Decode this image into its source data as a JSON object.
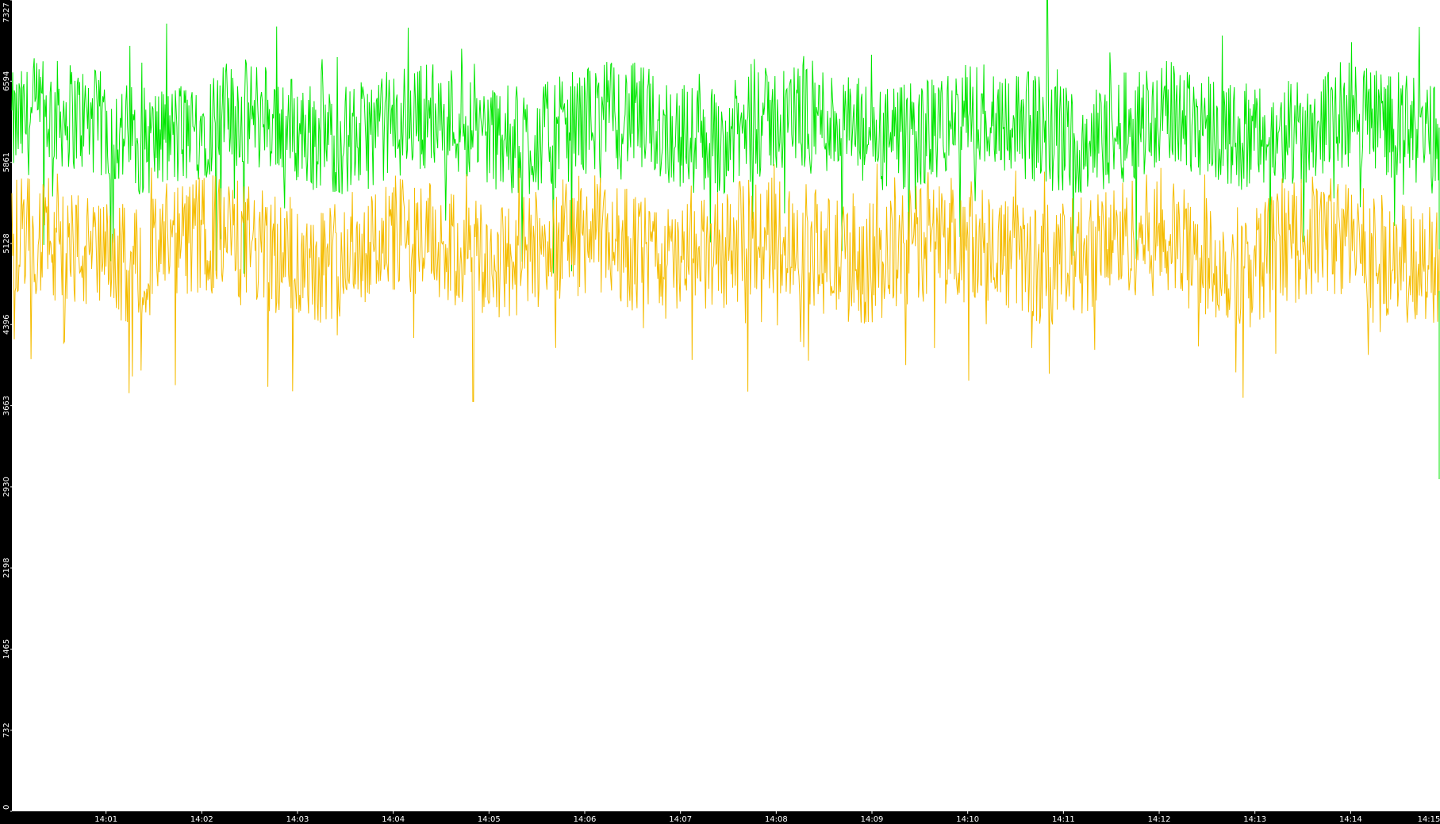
{
  "chart_data": {
    "type": "line",
    "title": "",
    "xlabel": "",
    "ylabel": "",
    "ylim": [
      0,
      7327
    ],
    "y_ticks": [
      0,
      732,
      1465,
      2198,
      2930,
      3663,
      4396,
      5128,
      5861,
      6594,
      7327
    ],
    "x_range": [
      "14:00:01",
      "14:14:56"
    ],
    "x_ticks": [
      "14:01",
      "14:02",
      "14:03",
      "14:04",
      "14:05",
      "14:06",
      "14:07",
      "14:08",
      "14:09",
      "14:10",
      "14:11",
      "14:12",
      "14:13",
      "14:14",
      "14:15"
    ],
    "grid": false,
    "legend": "none",
    "series": [
      {
        "color": "#00e600",
        "summary": {
          "typical_low": 5700,
          "typical_high": 6650,
          "min": 4800,
          "max": 7327,
          "last": 3000
        },
        "samples": [
          {
            "t": "14:00:01",
            "v": 6200
          },
          {
            "t": "14:01:00",
            "v": 6250
          },
          {
            "t": "14:02:00",
            "v": 6300
          },
          {
            "t": "14:03:00",
            "v": 6200
          },
          {
            "t": "14:04:00",
            "v": 6250
          },
          {
            "t": "14:05:00",
            "v": 6150
          },
          {
            "t": "14:06:00",
            "v": 6250
          },
          {
            "t": "14:07:00",
            "v": 6200
          },
          {
            "t": "14:08:00",
            "v": 6200
          },
          {
            "t": "14:09:00",
            "v": 6250
          },
          {
            "t": "14:10:00",
            "v": 6250
          },
          {
            "t": "14:10:50",
            "v": 7327
          },
          {
            "t": "14:11:00",
            "v": 6300
          },
          {
            "t": "14:12:00",
            "v": 6200
          },
          {
            "t": "14:13:00",
            "v": 6250
          },
          {
            "t": "14:14:00",
            "v": 6200
          },
          {
            "t": "14:14:56",
            "v": 3000
          }
        ]
      },
      {
        "color": "#f5bc00",
        "summary": {
          "typical_low": 4550,
          "typical_high": 5600,
          "min": 3700,
          "max": 6000,
          "last": 4700
        },
        "samples": [
          {
            "t": "14:00:01",
            "v": 5100
          },
          {
            "t": "14:01:00",
            "v": 5150
          },
          {
            "t": "14:02:00",
            "v": 5050
          },
          {
            "t": "14:03:00",
            "v": 5100
          },
          {
            "t": "14:04:00",
            "v": 5100
          },
          {
            "t": "14:04:50",
            "v": 3700
          },
          {
            "t": "14:05:00",
            "v": 5050
          },
          {
            "t": "14:06:00",
            "v": 5100
          },
          {
            "t": "14:07:00",
            "v": 5100
          },
          {
            "t": "14:08:00",
            "v": 5050
          },
          {
            "t": "14:09:00",
            "v": 5100
          },
          {
            "t": "14:10:00",
            "v": 5150
          },
          {
            "t": "14:11:00",
            "v": 5200
          },
          {
            "t": "14:12:00",
            "v": 5050
          },
          {
            "t": "14:13:00",
            "v": 5100
          },
          {
            "t": "14:14:00",
            "v": 5100
          },
          {
            "t": "14:14:56",
            "v": 4700
          }
        ]
      }
    ]
  }
}
